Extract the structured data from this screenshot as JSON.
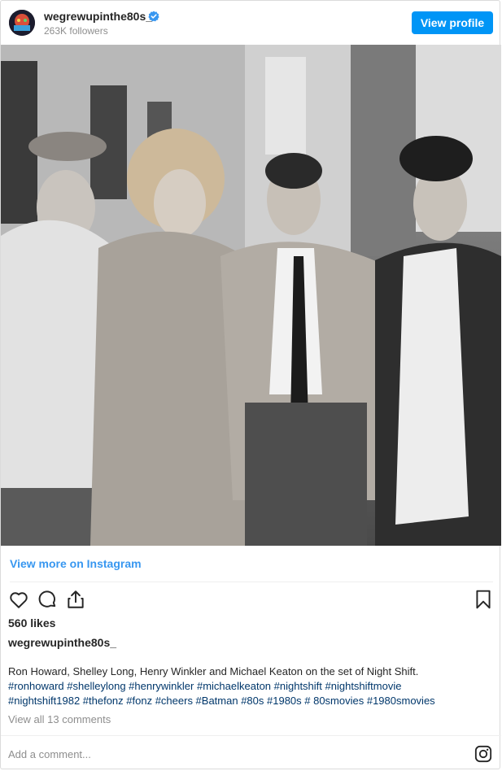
{
  "header": {
    "username": "wegrewupinthe80s_",
    "followers": "263K followers",
    "view_profile_label": "View profile",
    "avatar_icon": "profile-avatar",
    "verified_icon": "verified-badge-icon",
    "colors": {
      "accent": "#0095f6",
      "verified": "#3897f0"
    }
  },
  "post": {
    "photo_kind": "black-and-white group photo",
    "view_more_label": "View more on Instagram",
    "actions": {
      "like_icon": "heart-icon",
      "comment_icon": "comment-icon",
      "share_icon": "share-icon",
      "save_icon": "bookmark-icon"
    },
    "likes": "560 likes",
    "caption_username": "wegrewupinthe80s_",
    "caption_text": "Ron Howard, Shelley Long, Henry Winkler and Michael Keaton on the set of Night Shift.",
    "hashtags_line1": "#ronhoward #shelleylong #henrywinkler #michaelkeaton #nightshift #nightshiftmovie",
    "hashtags_line2": "#nightshift1982 #thefonz #fonz #cheers #Batman #80s #1980s # 80smovies #1980smovies",
    "view_comments_label": "View all 13 comments",
    "link_color": "#00376b"
  },
  "footer": {
    "comment_placeholder": "Add a comment...",
    "instagram_icon": "instagram-logo-icon"
  }
}
